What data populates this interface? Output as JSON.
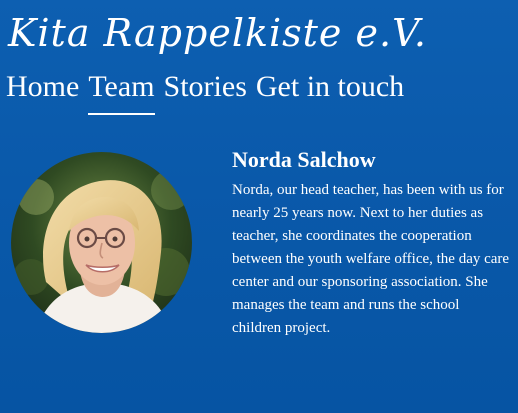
{
  "site": {
    "logo_text": "Kita Rappelkiste e.V."
  },
  "nav": {
    "items": [
      {
        "label": "Home"
      },
      {
        "label": "Team"
      },
      {
        "label": "Stories"
      },
      {
        "label": "Get in touch"
      }
    ],
    "active": "Team"
  },
  "profile": {
    "name": "Norda Salchow",
    "bio": "Norda, our head teacher, has been with us for nearly 25 years now. Next to her duties as teacher, she coordinates the cooperation between the youth welfare office, the day care center and our sponsoring association. She manages the team and runs the school children project."
  },
  "colors": {
    "background_top": "#0d5fb1",
    "background_bottom": "#0654a3",
    "text": "#ffffff"
  }
}
